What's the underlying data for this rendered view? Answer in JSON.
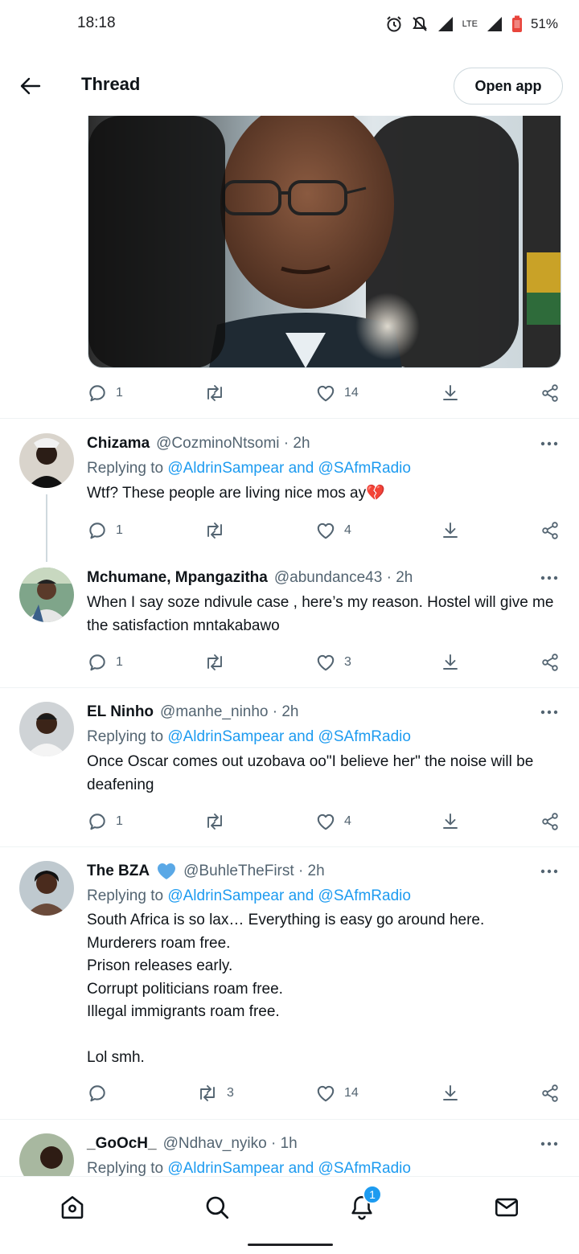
{
  "status_bar": {
    "time": "18:18",
    "network": "LTE",
    "battery": "51%"
  },
  "header": {
    "title": "Thread",
    "open_app_label": "Open app"
  },
  "main_tweet_actions": {
    "replies": "1",
    "retweets": "",
    "likes": "14"
  },
  "tweets": [
    {
      "name": "Chizama",
      "handle": "@CozminoNtsomi · 2h",
      "reply_prefix": "Replying to ",
      "reply_targets": "@AldrinSampear and @SAfmRadio",
      "text": "Wtf? These people are living nice mos ay💔",
      "replies": "1",
      "retweets": "",
      "likes": "4"
    },
    {
      "name": "Mchumane, Mpangazitha",
      "handle": "@abundance43 · 2h",
      "text": "When I say soze ndivule case , here’s my reason. Hostel will give me the satisfaction mntakabawo",
      "replies": "1",
      "retweets": "",
      "likes": "3"
    },
    {
      "name": "EL Ninho",
      "handle": "@manhe_ninho · 2h",
      "reply_prefix": "Replying to ",
      "reply_targets": "@AldrinSampear and @SAfmRadio",
      "text": "Once Oscar comes out uzobava oo\"I believe her\" the noise will be deafening",
      "replies": "1",
      "retweets": "",
      "likes": "4"
    },
    {
      "name": "The BZA",
      "handle": "@BuhleTheFirst · 2h",
      "reply_prefix": "Replying to ",
      "reply_targets": "@AldrinSampear and @SAfmRadio",
      "text": "South Africa is so lax… Everything is easy go around here.\nMurderers roam free.\nPrison releases early.\nCorrupt politicians roam free.\nIllegal immigrants roam free.\n\nLol smh.",
      "replies": "",
      "retweets": "3",
      "likes": "14"
    },
    {
      "name": "_GoOcH_",
      "handle": "@Ndhav_nyiko · 1h",
      "reply_prefix": "Replying to ",
      "reply_targets": "@AldrinSampear and @SAfmRadio"
    }
  ],
  "bottom_nav": {
    "notification_count": "1"
  },
  "colors": {
    "accent": "#1d9bf0",
    "secondary_text": "#536471",
    "primary_text": "#0f1419",
    "divider": "#eff3f4"
  },
  "icons": [
    "back-arrow-icon",
    "reply-icon",
    "retweet-icon",
    "like-icon",
    "download-icon",
    "share-icon",
    "more-icon",
    "home-icon",
    "search-icon",
    "notifications-icon",
    "messages-icon",
    "verified-heart-icon"
  ]
}
